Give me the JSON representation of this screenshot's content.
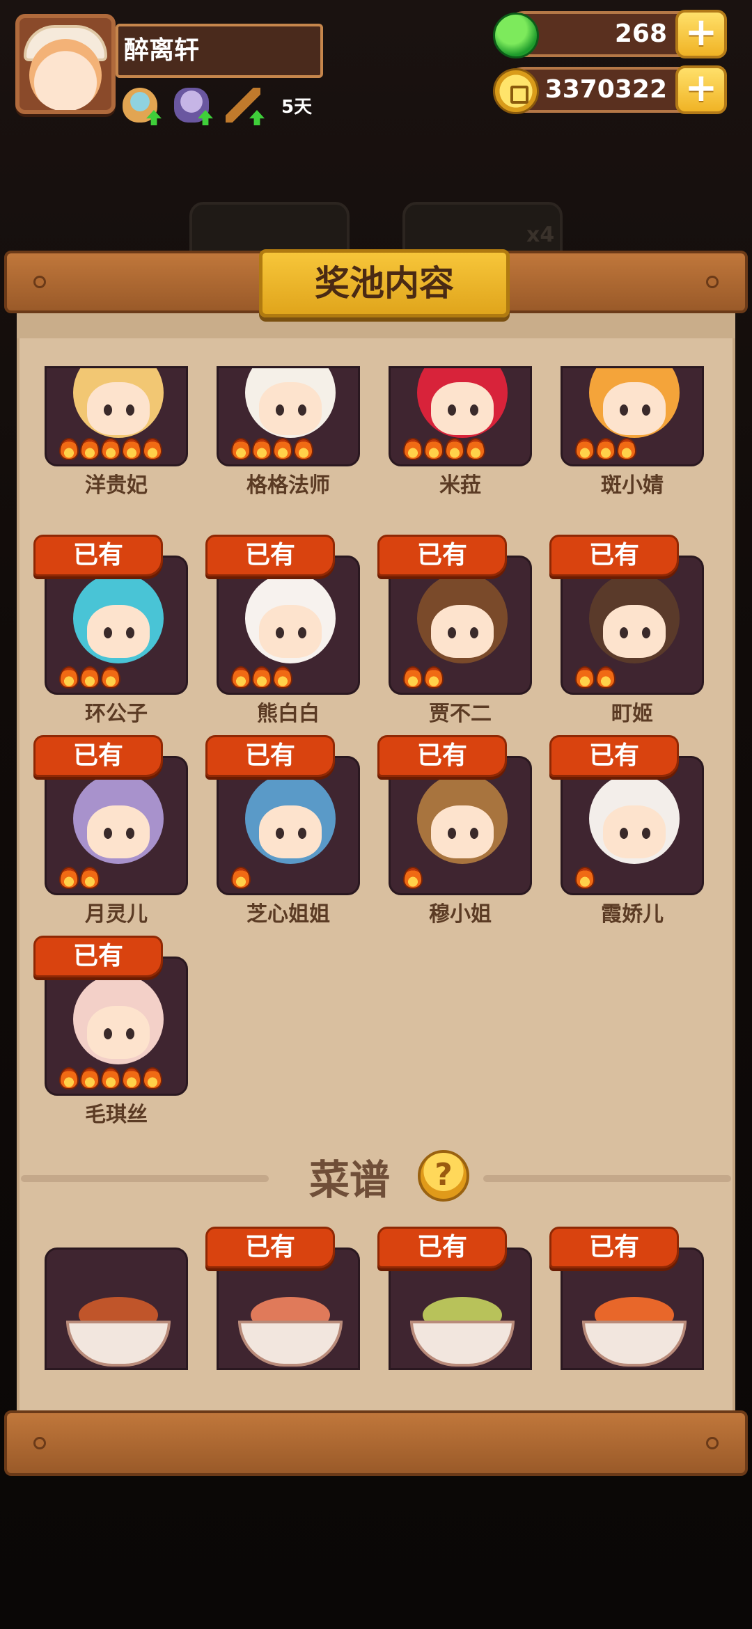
{
  "player": {
    "name": "醉离轩",
    "days": "5天",
    "status_icons": [
      "bowl-icon",
      "bag-icon",
      "tool-icon"
    ]
  },
  "currency": {
    "jade": "268",
    "coins": "3370322"
  },
  "panel": {
    "title": "奖池内容",
    "owned_badge": "已有",
    "characters": [
      {
        "name": "洋贵妃",
        "owned": false,
        "flames": 5,
        "color": "#f2c773"
      },
      {
        "name": "格格法师",
        "owned": false,
        "flames": 4,
        "color": "#f5f0e8"
      },
      {
        "name": "米菈",
        "owned": false,
        "flames": 4,
        "color": "#d8233a"
      },
      {
        "name": "斑小婧",
        "owned": false,
        "flames": 3,
        "color": "#f4a43a"
      },
      {
        "name": "环公子",
        "owned": true,
        "flames": 3,
        "color": "#49c4d6"
      },
      {
        "name": "熊白白",
        "owned": true,
        "flames": 3,
        "color": "#f7f2ee"
      },
      {
        "name": "贾不二",
        "owned": true,
        "flames": 2,
        "color": "#7a4a2a"
      },
      {
        "name": "町姬",
        "owned": true,
        "flames": 2,
        "color": "#5a3a2a"
      },
      {
        "name": "月灵儿",
        "owned": true,
        "flames": 2,
        "color": "#a892cc"
      },
      {
        "name": "芝心姐姐",
        "owned": true,
        "flames": 1,
        "color": "#5a9ac8"
      },
      {
        "name": "穆小姐",
        "owned": true,
        "flames": 1,
        "color": "#a8743e"
      },
      {
        "name": "霞娇儿",
        "owned": true,
        "flames": 1,
        "color": "#f3eeea"
      },
      {
        "name": "毛琪丝",
        "owned": true,
        "flames": 5,
        "color": "#f3d0c8"
      }
    ],
    "recipe_title": "菜谱",
    "help_icon": "?",
    "recipes": [
      {
        "owned": false,
        "food_color": "#c0552a"
      },
      {
        "owned": true,
        "food_color": "#e07a5a"
      },
      {
        "owned": true,
        "food_color": "#b8c25a"
      },
      {
        "owned": true,
        "food_color": "#e8672a"
      }
    ]
  }
}
